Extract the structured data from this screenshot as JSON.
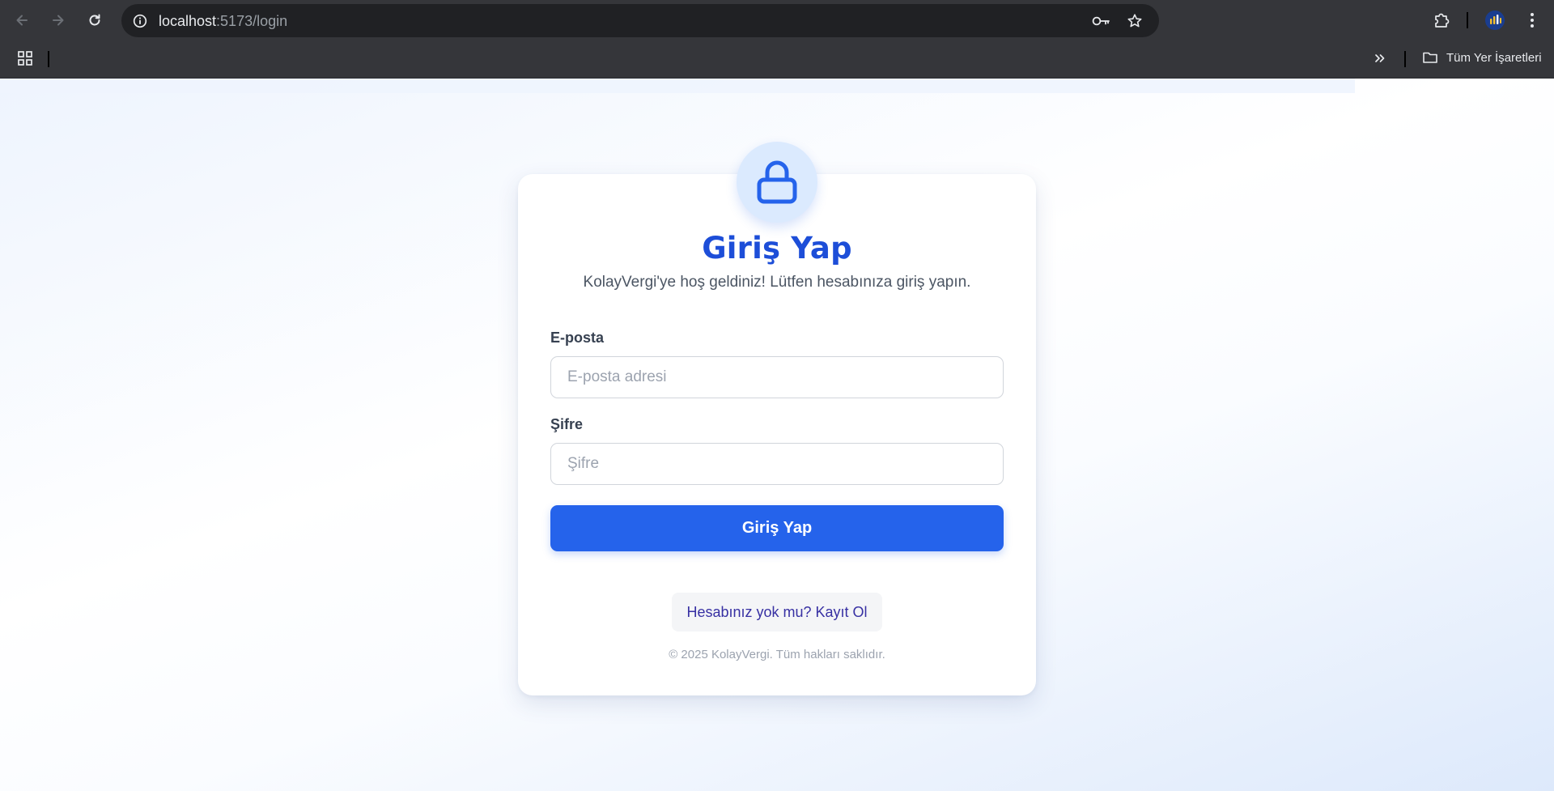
{
  "browser": {
    "url_host": "localhost",
    "url_rest": ":5173/login",
    "bookmarks_folder_label": "Tüm Yer İşaretleri",
    "icons": {
      "back": "arrow-left-icon",
      "forward": "arrow-right-icon",
      "reload": "reload-icon",
      "site_info": "info-icon",
      "password": "key-icon",
      "bookmark": "star-icon",
      "extensions": "puzzle-icon",
      "profile": "profile-avatar",
      "menu": "kebab-menu-icon",
      "apps": "apps-grid-icon",
      "overflow": "double-chevron-right-icon",
      "folder": "folder-icon"
    }
  },
  "login": {
    "icon": "lock-icon",
    "title": "Giriş Yap",
    "subtitle": "KolayVergi'ye hoş geldiniz! Lütfen hesabınıza giriş yapın.",
    "email_label": "E-posta",
    "email_value": "",
    "email_placeholder": "E-posta adresi",
    "password_label": "Şifre",
    "password_value": "",
    "password_placeholder": "Şifre",
    "submit_label": "Giriş Yap",
    "register_link": "Hesabınız yok mu? Kayıt Ol",
    "footer": "© 2025 KolayVergi. Tüm hakları saklıdır."
  },
  "colors": {
    "accent": "#2563eb",
    "title": "#1d4ed8",
    "lock_bg": "#dbeafe",
    "link": "#3730a3"
  }
}
